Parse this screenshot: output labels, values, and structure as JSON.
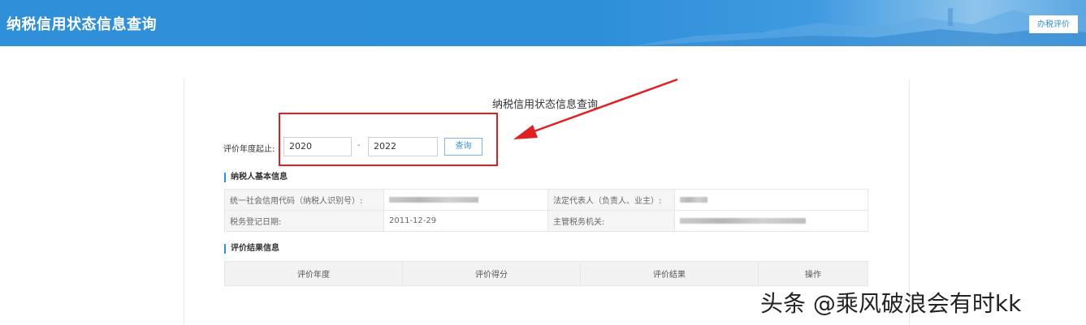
{
  "header": {
    "title": "纳税信用状态信息查询",
    "eval_button": "办税评价",
    "accent": "#2f8fd8"
  },
  "query": {
    "title": "纳税信用状态信息查询",
    "range_label": "评价年度起止:",
    "start_year": "2020",
    "separator": "-",
    "end_year": "2022",
    "button": "查询"
  },
  "basic_info": {
    "section_title": "纳税人基本信息",
    "credit_code_label": "统一社会信用代码（纳税人识别号）:",
    "legal_rep_label": "法定代表人（负责人、业主）:",
    "reg_date_label": "税务登记日期:",
    "reg_date_value": "2011-12-29",
    "tax_office_label": "主管税务机关:"
  },
  "result": {
    "section_title": "评价结果信息",
    "columns": [
      "评价年度",
      "评价得分",
      "评价结果",
      "操作"
    ]
  },
  "watermark": "头条 @乘风破浪会有时kk",
  "annotation_color": "#e02020"
}
